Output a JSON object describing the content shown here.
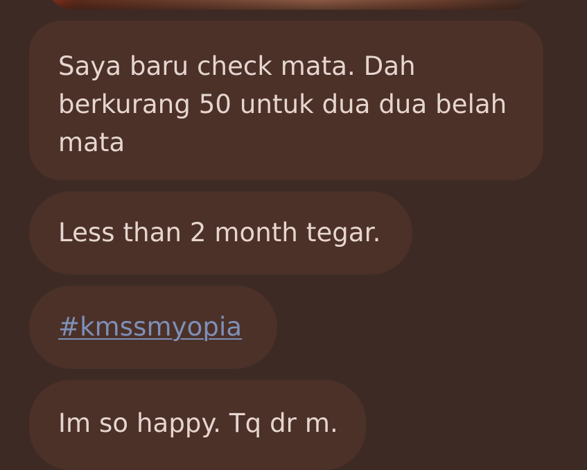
{
  "messages": [
    {
      "lines": [
        "Saya baru check mata. Dah",
        "berkurang 50 untuk dua dua belah",
        "mata"
      ]
    },
    {
      "text": "Less than 2 month tegar."
    },
    {
      "hashtag": "#kmssmyopia"
    },
    {
      "text": "Im so happy. Tq dr m."
    }
  ],
  "colors": {
    "background": "#3e2a24",
    "bubble": "#4c3129",
    "text": "#e6d6cf",
    "link": "#7e90b8"
  }
}
